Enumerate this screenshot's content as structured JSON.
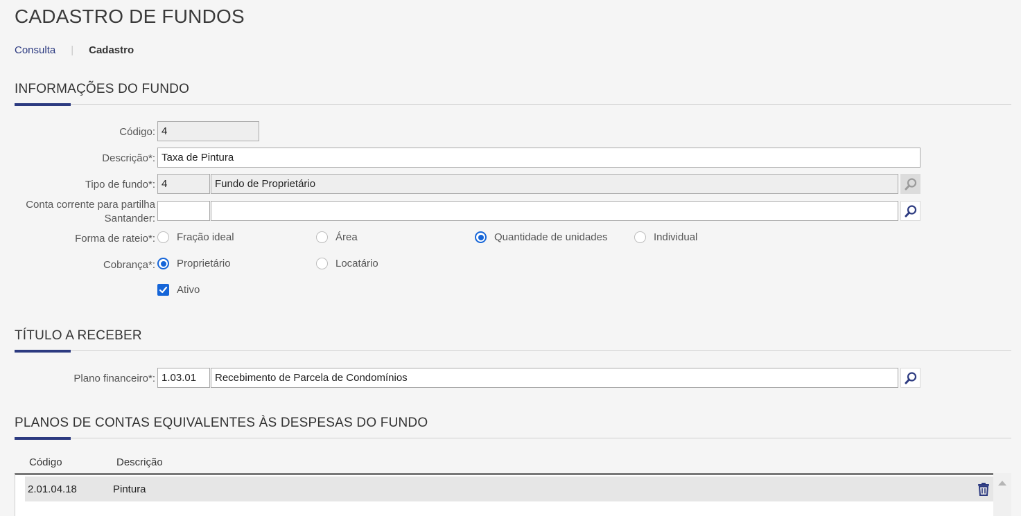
{
  "page": {
    "title": "CADASTRO DE FUNDOS"
  },
  "breadcrumb": {
    "link": "Consulta",
    "separator": "|",
    "current": "Cadastro"
  },
  "section_info": {
    "title": "INFORMAÇÕES DO FUNDO",
    "codigo": {
      "label": "Código:",
      "value": "4"
    },
    "descricao": {
      "label": "Descrição*:",
      "value": "Taxa de Pintura"
    },
    "tipo_fundo": {
      "label": "Tipo de fundo*:",
      "code": "4",
      "name": "Fundo de Proprietário"
    },
    "conta_corrente": {
      "label_line1": "Conta corrente para partilha",
      "label_line2": "Santander:",
      "code": "",
      "name": ""
    },
    "forma_rateio": {
      "label": "Forma de rateio*:",
      "options": [
        "Fração ideal",
        "Área",
        "Quantidade de unidades",
        "Individual"
      ],
      "selected": "Quantidade de unidades"
    },
    "cobranca": {
      "label": "Cobrança*:",
      "options": [
        "Proprietário",
        "Locatário"
      ],
      "selected": "Proprietário"
    },
    "ativo": {
      "label": "Ativo",
      "checked": true
    }
  },
  "section_titulo": {
    "title": "TÍTULO A RECEBER",
    "plano_financeiro": {
      "label": "Plano financeiro*:",
      "code": "1.03.01",
      "name": "Recebimento de Parcela de Condomínios"
    }
  },
  "section_planos": {
    "title": "PLANOS DE CONTAS EQUIVALENTES ÀS DESPESAS DO FUNDO",
    "columns": [
      "Código",
      "Descrição"
    ],
    "rows": [
      {
        "codigo": "2.01.04.18",
        "descricao": "Pintura"
      }
    ]
  },
  "colors": {
    "accent": "#2c3a80",
    "radio_selected": "#1565d8",
    "background": "#f5f5f5"
  }
}
